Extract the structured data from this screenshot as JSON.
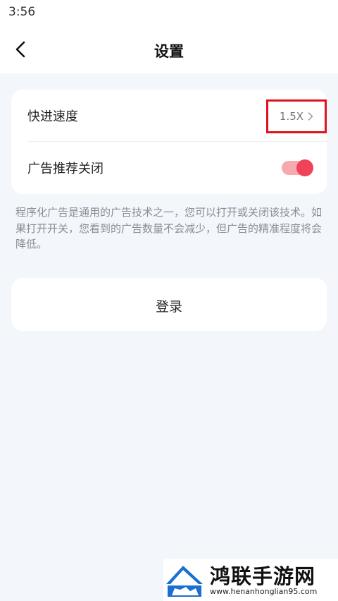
{
  "status_bar": {
    "time": "3:56"
  },
  "header": {
    "title": "设置"
  },
  "settings": {
    "speed": {
      "label": "快进速度",
      "value": "1.5X"
    },
    "ad_toggle": {
      "label": "广告推荐关闭",
      "enabled": true
    }
  },
  "description": "程序化广告是通用的广告技术之一，您可以打开或关闭该技术。如果打开开关，您看到的广告数量不会减少，但广告的精准程度将会降低。",
  "login": {
    "label": "登录"
  },
  "colors": {
    "toggle_on": "#f0435a",
    "highlight_box": "#e1111b",
    "background": "#f3f6fb"
  },
  "watermark": {
    "title": "鸿联手游网",
    "url": "www.henanhonglian95.com"
  }
}
